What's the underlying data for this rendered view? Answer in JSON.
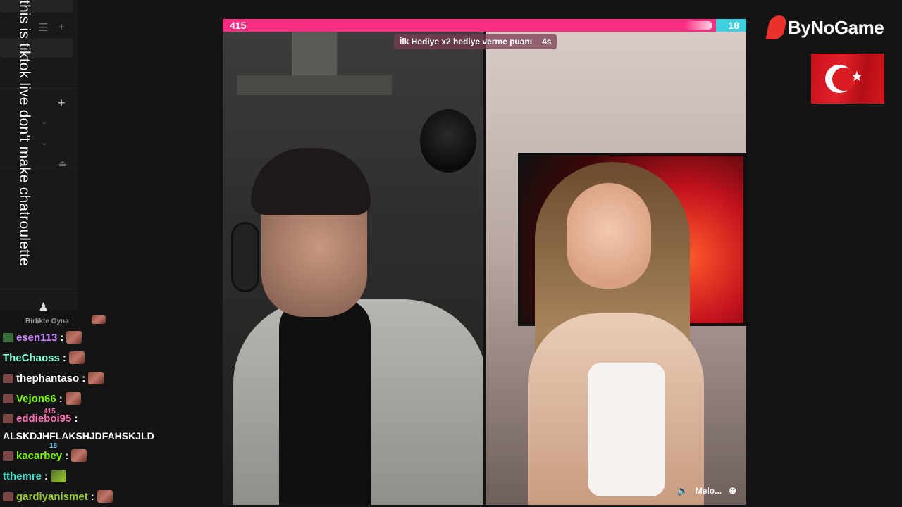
{
  "caption": {
    "text": "this is tiktok live don't make chatroulette"
  },
  "sidebar": {
    "icons": [
      "list-icon",
      "plus-icon",
      "chevron-down-icon",
      "user-icon",
      "joystick-icon"
    ]
  },
  "chat": {
    "truncated_label": "Birlikte Oyna",
    "messages": [
      {
        "user": "esen113",
        "color": "#c982ff",
        "badge": "green",
        "emote": "face"
      },
      {
        "user": "TheChaoss",
        "color": "#7fffd4",
        "badge": "none",
        "emote": "face"
      },
      {
        "user": "thephantaso",
        "color": "#ffffff",
        "badge": "red",
        "emote": "face"
      },
      {
        "user": "Vejon66",
        "color": "#7cfc00",
        "badge": "red",
        "emote": "face"
      },
      {
        "user": "eddieboi95",
        "color": "#ff6fb5",
        "badge": "red",
        "emote": "none",
        "text": "ALSKDJHFLAKSHJDFAHSKJLD"
      },
      {
        "user": "kacarbey",
        "color": "#7cfc00",
        "badge": "red",
        "emote": "face"
      },
      {
        "user": "tthemre",
        "color": "#40e0d0",
        "badge": "none",
        "emote": "tank"
      },
      {
        "user": "gardiyanismet",
        "color": "#9acd32",
        "badge": "red",
        "emote": "face"
      }
    ],
    "colon": ":",
    "overlay_score_left": "415",
    "overlay_score_right": "18"
  },
  "stream": {
    "score_left": "415",
    "score_right": "18",
    "banner_text": "İlk Hediye x2 hediye verme puanı",
    "banner_timer": "4s",
    "right_user": "Melo...",
    "colors": {
      "pk_left": "#fe2c80",
      "pk_right": "#3fd0e0"
    }
  },
  "brand": {
    "name": "ByNoGame"
  }
}
